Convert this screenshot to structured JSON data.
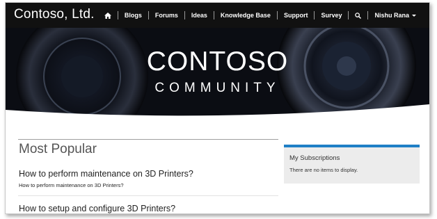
{
  "nav": {
    "brand": "Contoso, Ltd.",
    "home_icon": "home-icon",
    "items": [
      "Blogs",
      "Forums",
      "Ideas",
      "Knowledge Base",
      "Support",
      "Survey"
    ],
    "search_icon": "search-icon",
    "user": "Nishu Rana"
  },
  "hero": {
    "title": "CONTOSO",
    "subtitle": "COMMUNITY"
  },
  "main": {
    "section_title": "Most Popular",
    "items": [
      {
        "title": "How to perform maintenance on 3D Printers?",
        "desc": "How to perform maintenance on 3D Printers?"
      },
      {
        "title": "How to setup and configure 3D Printers?"
      }
    ]
  },
  "sidebar": {
    "title": "My Subscriptions",
    "empty_text": "There are no items to display."
  },
  "colors": {
    "nav_bg": "#111111",
    "accent": "#1f7fc6",
    "panel_bg": "#ececec"
  }
}
